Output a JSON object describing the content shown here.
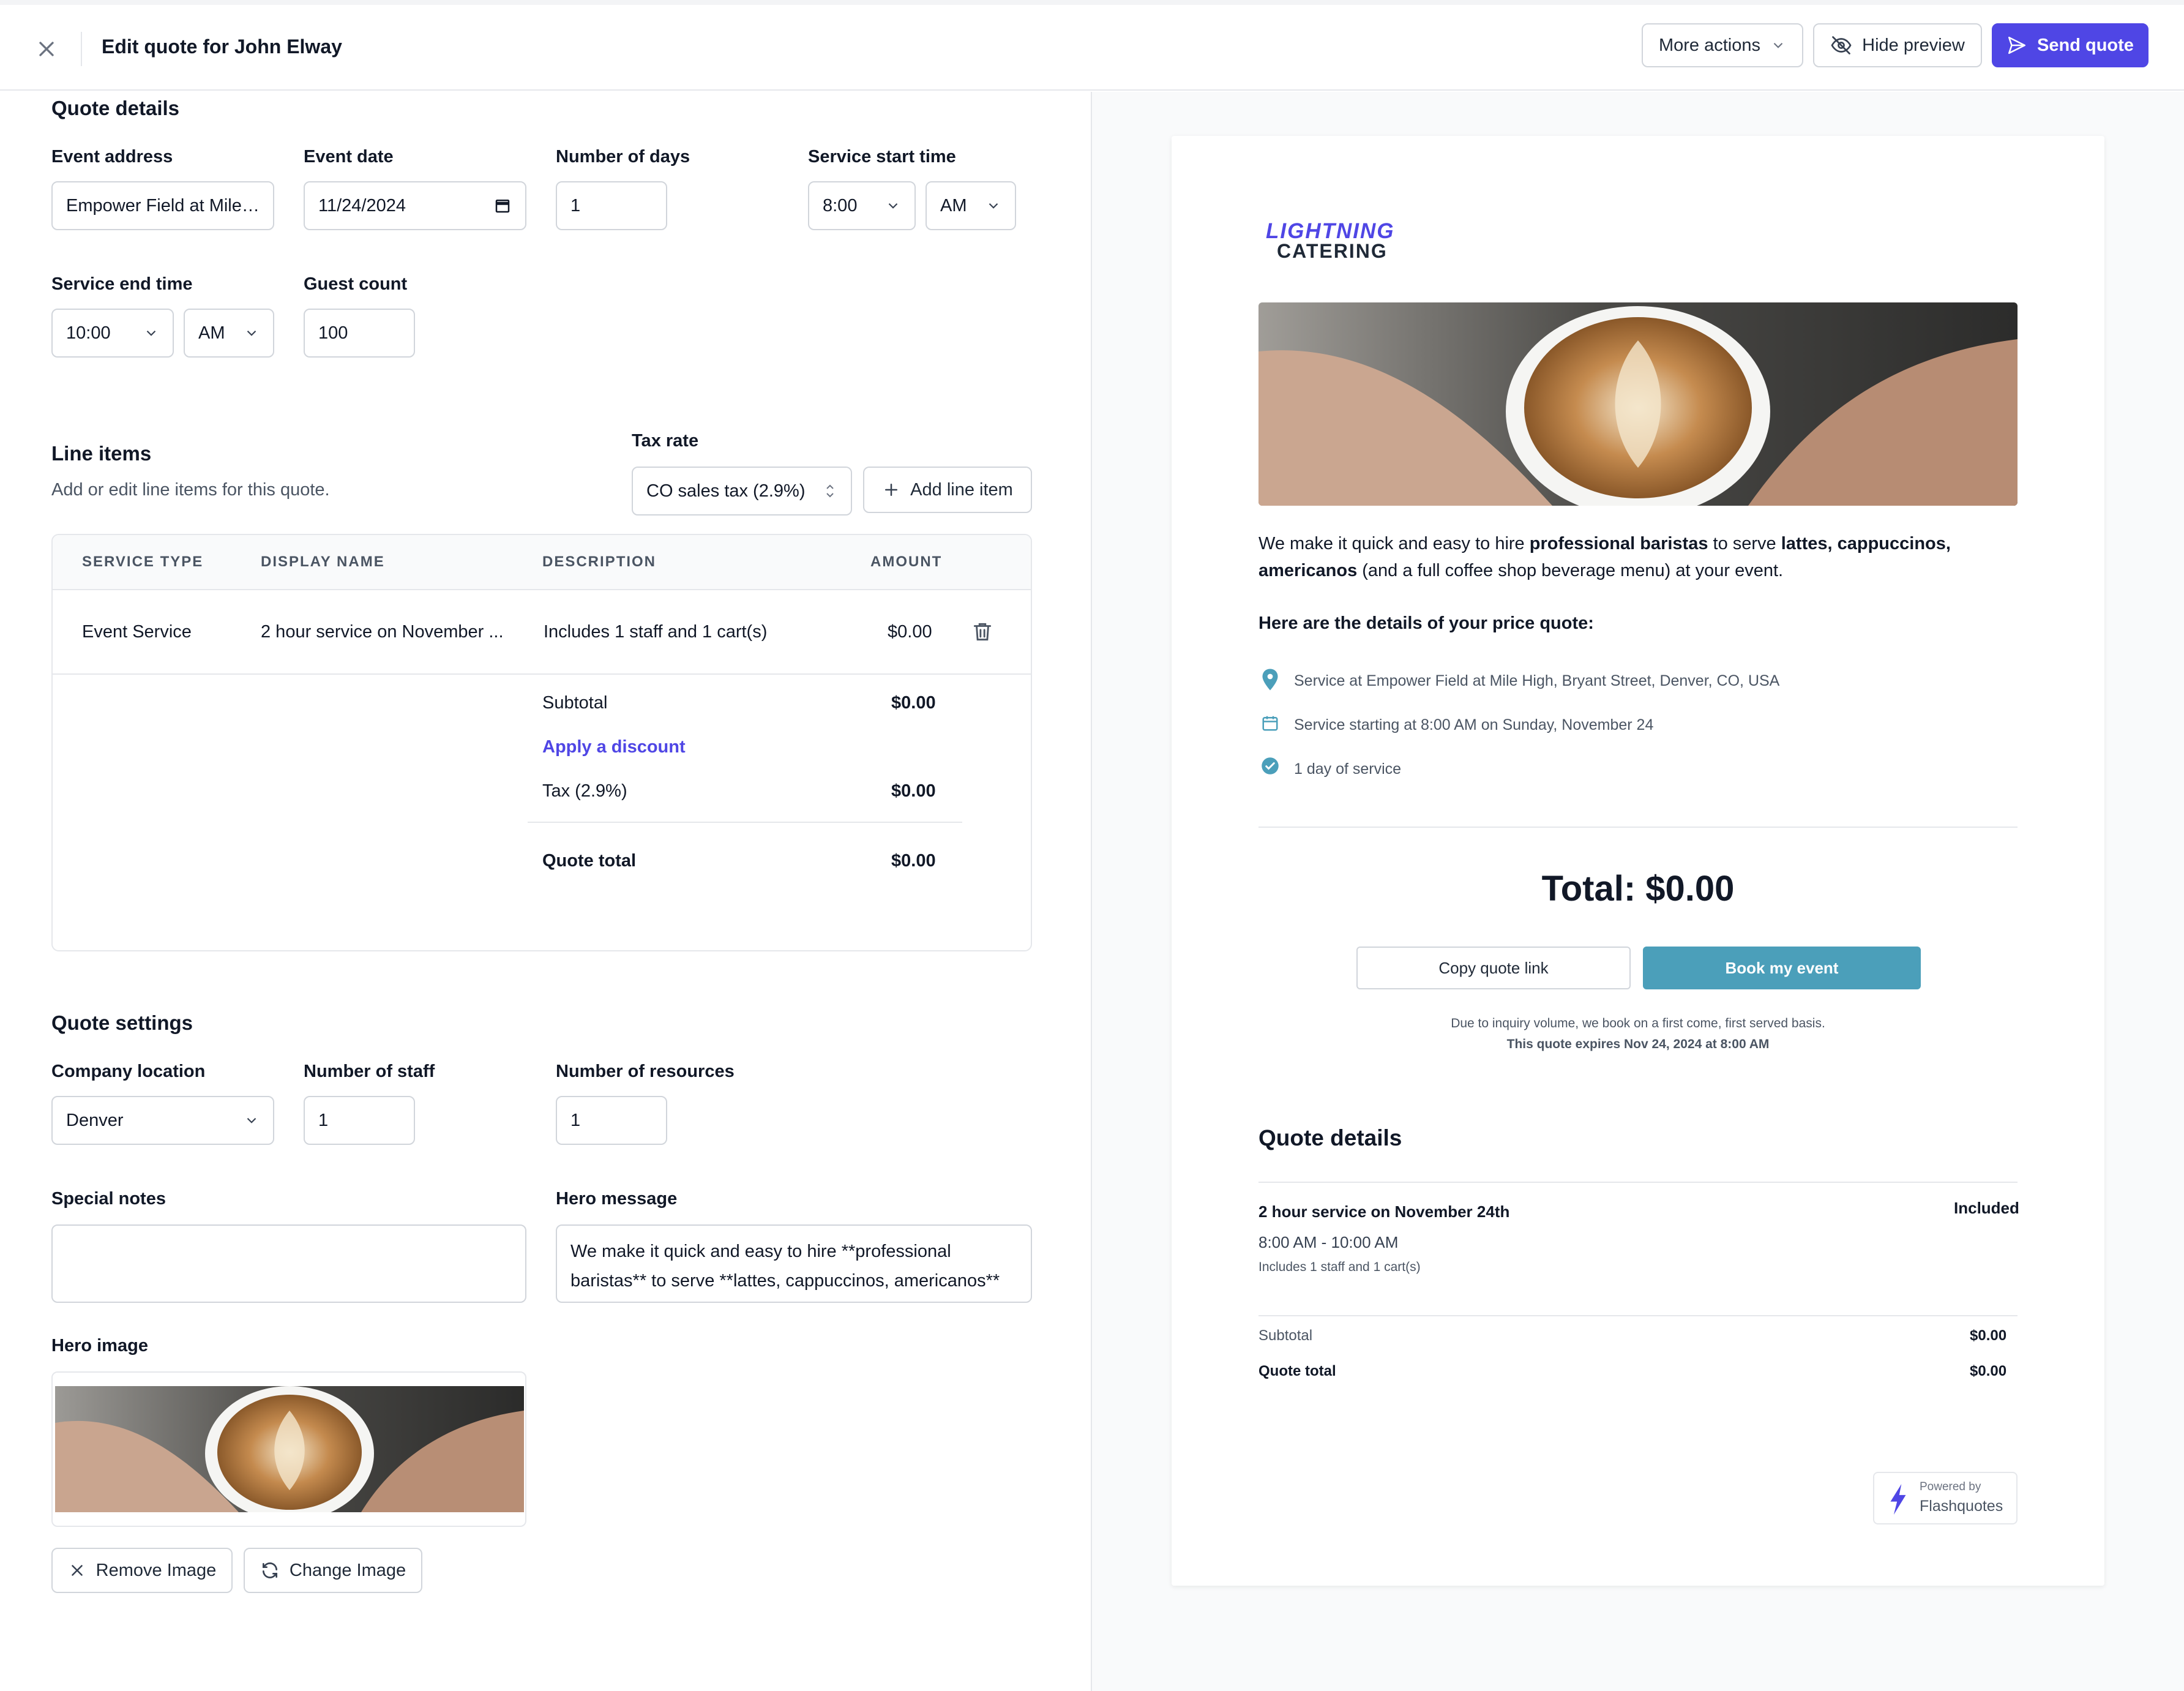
{
  "header": {
    "title": "Edit quote for John Elway",
    "more_actions": "More actions",
    "hide_preview": "Hide preview",
    "send_quote": "Send quote"
  },
  "quote_details": {
    "title": "Quote details",
    "event_address_label": "Event address",
    "event_address_value": "Empower Field at Mile ...",
    "event_date_label": "Event date",
    "event_date_value": "11/24/2024",
    "days_label": "Number of days",
    "days_value": "1",
    "start_time_label": "Service start time",
    "start_time_value": "8:00",
    "start_ampm": "AM",
    "end_time_label": "Service end time",
    "end_time_value": "10:00",
    "end_ampm": "AM",
    "guest_count_label": "Guest count",
    "guest_count_value": "100"
  },
  "line_items": {
    "title": "Line items",
    "subtitle": "Add or edit line items for this quote.",
    "tax_rate_label": "Tax rate",
    "tax_rate_value": "CO sales tax (2.9%)",
    "add_line_item": "Add line item",
    "columns": [
      "SERVICE TYPE",
      "DISPLAY NAME",
      "DESCRIPTION",
      "AMOUNT"
    ],
    "rows": [
      {
        "service_type": "Event Service",
        "display_name": "2 hour service on November ...",
        "description": "Includes 1 staff and 1 cart(s)",
        "amount": "$0.00"
      }
    ],
    "subtotal_label": "Subtotal",
    "subtotal_value": "$0.00",
    "apply_discount": "Apply a discount",
    "tax_label": "Tax (2.9%)",
    "tax_value": "$0.00",
    "total_label": "Quote total",
    "total_value": "$0.00"
  },
  "quote_settings": {
    "title": "Quote settings",
    "company_location_label": "Company location",
    "company_location_value": "Denver",
    "staff_label": "Number of staff",
    "staff_value": "1",
    "resources_label": "Number of resources",
    "resources_value": "1",
    "special_notes_label": "Special notes",
    "special_notes_value": "",
    "hero_message_label": "Hero message",
    "hero_message_value": "We make it quick and easy to hire **professional baristas** to serve **lattes, cappuccinos, americanos** (and a full coffee shop beverage menu) at your event.",
    "hero_image_label": "Hero image",
    "remove_image": "Remove Image",
    "change_image": "Change Image"
  },
  "preview": {
    "logo_line1": "LIGHTNING",
    "logo_line2": "CATERING",
    "hero_part1": "We make it quick and easy to hire ",
    "hero_bold1": "professional baristas",
    "hero_part2": " to serve ",
    "hero_bold2": "lattes, cappuccinos, americanos",
    "hero_part3": " (and a full coffee shop beverage menu) at your event.",
    "details_intro": "Here are the details of your price quote:",
    "detail_location": "Service at Empower Field at Mile High, Bryant Street, Denver, CO, USA",
    "detail_start": "Service starting at 8:00 AM on Sunday, November 24",
    "detail_days": "1 day of service",
    "total": "Total: $0.00",
    "copy_link": "Copy quote link",
    "book_event": "Book my event",
    "note_line1": "Due to inquiry volume, we book on a first come, first served basis.",
    "note_line2": "This quote expires Nov 24, 2024 at 8:00 AM",
    "details_title": "Quote details",
    "item_name": "2 hour service on November 24th",
    "item_status": "Included",
    "item_time": "8:00 AM - 10:00 AM",
    "item_desc": "Includes 1 staff and 1 cart(s)",
    "subtotal_label": "Subtotal",
    "subtotal_value": "$0.00",
    "total_label": "Quote total",
    "total_value": "$0.00",
    "powered_by": "Powered by",
    "powered_name": "Flashquotes"
  },
  "colors": {
    "primary": "#4f46e5",
    "teal": "#4b9fba",
    "border": "#d1d5db"
  }
}
